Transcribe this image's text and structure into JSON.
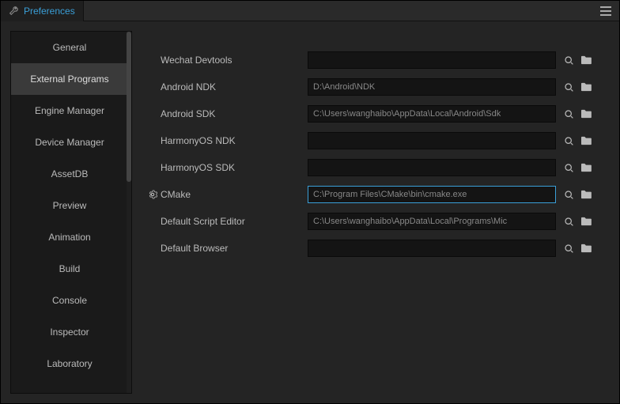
{
  "tab": {
    "title": "Preferences"
  },
  "sidebar": {
    "items": [
      {
        "label": "General",
        "active": false
      },
      {
        "label": "External Programs",
        "active": true
      },
      {
        "label": "Engine Manager",
        "active": false
      },
      {
        "label": "Device Manager",
        "active": false
      },
      {
        "label": "AssetDB",
        "active": false
      },
      {
        "label": "Preview",
        "active": false
      },
      {
        "label": "Animation",
        "active": false
      },
      {
        "label": "Build",
        "active": false
      },
      {
        "label": "Console",
        "active": false
      },
      {
        "label": "Inspector",
        "active": false
      },
      {
        "label": "Laboratory",
        "active": false
      }
    ]
  },
  "fields": [
    {
      "label": "Wechat Devtools",
      "value": "",
      "gear": false,
      "focused": false
    },
    {
      "label": "Android NDK",
      "value": "D:\\Android\\NDK",
      "gear": false,
      "focused": false
    },
    {
      "label": "Android SDK",
      "value": "C:\\Users\\wanghaibo\\AppData\\Local\\Android\\Sdk",
      "gear": false,
      "focused": false
    },
    {
      "label": "HarmonyOS NDK",
      "value": "",
      "gear": false,
      "focused": false
    },
    {
      "label": "HarmonyOS SDK",
      "value": "",
      "gear": false,
      "focused": false
    },
    {
      "label": "CMake",
      "value": "C:\\Program Files\\CMake\\bin\\cmake.exe",
      "gear": true,
      "focused": true
    },
    {
      "label": "Default Script Editor",
      "value": "C:\\Users\\wanghaibo\\AppData\\Local\\Programs\\Mic",
      "gear": false,
      "focused": false
    },
    {
      "label": "Default Browser",
      "value": "",
      "gear": false,
      "focused": false
    }
  ]
}
